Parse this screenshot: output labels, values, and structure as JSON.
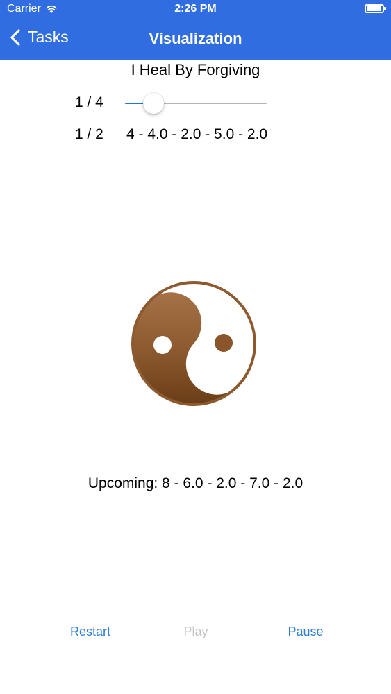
{
  "status_bar": {
    "carrier": "Carrier",
    "time": "2:26 PM"
  },
  "nav": {
    "back_label": "Tasks",
    "title": "Visualization"
  },
  "heading": "I Heal By Forgiving",
  "slider": {
    "label": "1 / 4",
    "value_fraction": 0.2
  },
  "sequence": {
    "label": "1 / 2",
    "text": "4 - 4.0 - 2.0 - 5.0 - 2.0"
  },
  "upcoming": "Upcoming: 8 - 6.0 - 2.0 - 7.0 - 2.0",
  "controls": {
    "restart": "Restart",
    "play": "Play",
    "pause": "Pause"
  },
  "colors": {
    "nav_bar": "#2f6de0",
    "accent": "#2f7fd6",
    "disabled": "#c5c5c5",
    "symbol_brown": "#8a552a"
  },
  "icons": {
    "back": "chevron-left-icon",
    "symbol": "yin-yang-icon",
    "wifi": "wifi-icon",
    "battery": "battery-icon"
  }
}
